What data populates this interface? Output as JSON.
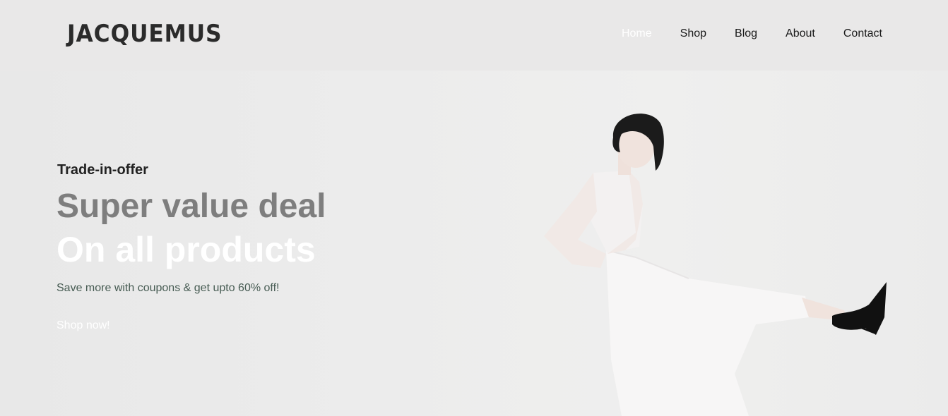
{
  "header": {
    "logo": "JACQUEMUS",
    "nav": [
      "Home",
      "Shop",
      "Blog",
      "About",
      "Contact"
    ],
    "active_nav": "Home"
  },
  "hero": {
    "kicker": "Trade-in-offer",
    "headline": "Super value deal",
    "headline2": "On all products",
    "subtext": "Save more with coupons & get upto 60% off!",
    "cta": "Shop now!"
  },
  "colors": {
    "headline": "#7e7e7e",
    "headline2": "#ffffff",
    "subtext": "#465b52",
    "active_nav": "#ffffff"
  }
}
